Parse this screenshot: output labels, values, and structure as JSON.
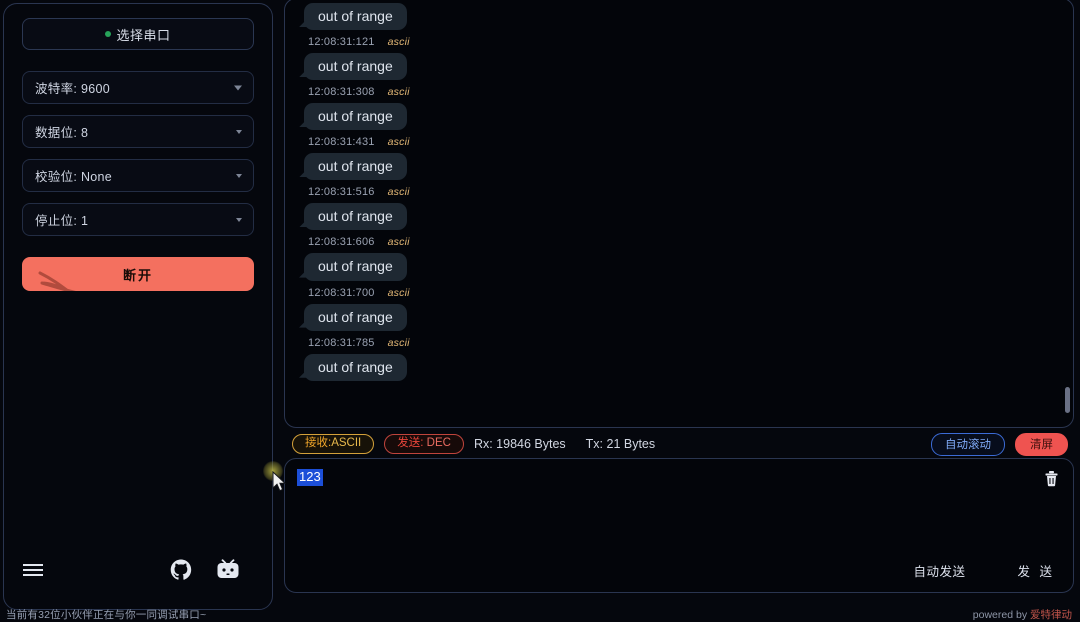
{
  "sidebar": {
    "port_button": {
      "label": "选择串口",
      "status_dot_color": "#27a35a"
    },
    "settings": [
      {
        "name": "baud-rate",
        "label": "波特率: 9600"
      },
      {
        "name": "data-bits",
        "label": "数据位: 8"
      },
      {
        "name": "parity",
        "label": "校验位: None"
      },
      {
        "name": "stop-bits",
        "label": "停止位: 1"
      }
    ],
    "disconnect_label": "断开",
    "disconnect_color": "#f4705f",
    "footer_icons": [
      {
        "name": "menu-icon"
      },
      {
        "name": "github-icon"
      },
      {
        "name": "bilibili-icon"
      }
    ]
  },
  "log": {
    "entries": [
      {
        "type": "message",
        "text": "out of range"
      },
      {
        "type": "meta",
        "time": "12:08:31:121",
        "format": "ascii"
      },
      {
        "type": "message",
        "text": "out of range"
      },
      {
        "type": "meta",
        "time": "12:08:31:308",
        "format": "ascii"
      },
      {
        "type": "message",
        "text": "out of range"
      },
      {
        "type": "meta",
        "time": "12:08:31:431",
        "format": "ascii"
      },
      {
        "type": "message",
        "text": "out of range"
      },
      {
        "type": "meta",
        "time": "12:08:31:516",
        "format": "ascii"
      },
      {
        "type": "message",
        "text": "out of range"
      },
      {
        "type": "meta",
        "time": "12:08:31:606",
        "format": "ascii"
      },
      {
        "type": "message",
        "text": "out of range"
      },
      {
        "type": "meta",
        "time": "12:08:31:700",
        "format": "ascii"
      },
      {
        "type": "message",
        "text": "out of range"
      },
      {
        "type": "meta",
        "time": "12:08:31:785",
        "format": "ascii"
      },
      {
        "type": "message",
        "text": "out of range"
      }
    ]
  },
  "status_strip": {
    "receive_pill": {
      "prefix": "接收:",
      "value": "ASCII",
      "color": "#e8b94c"
    },
    "send_pill": {
      "prefix": "发送:",
      "value": " DEC",
      "color": "#e86b60"
    },
    "rx_counter": "Rx: 19846 Bytes",
    "tx_counter": "Tx: 21 Bytes",
    "auto_scroll_label": "自动滚动",
    "clear_label": "清屏",
    "clear_color": "#ef5350"
  },
  "send_panel": {
    "input_value": "123",
    "trash_icon": "trash-icon",
    "auto_send_label": "自动发送",
    "send_label": "发 送"
  },
  "bottom_bar": {
    "left_text": "当前有32位小伙伴正在与你一同调试串口~",
    "right_prefix": "powered by ",
    "right_brand": "爱特律动"
  }
}
